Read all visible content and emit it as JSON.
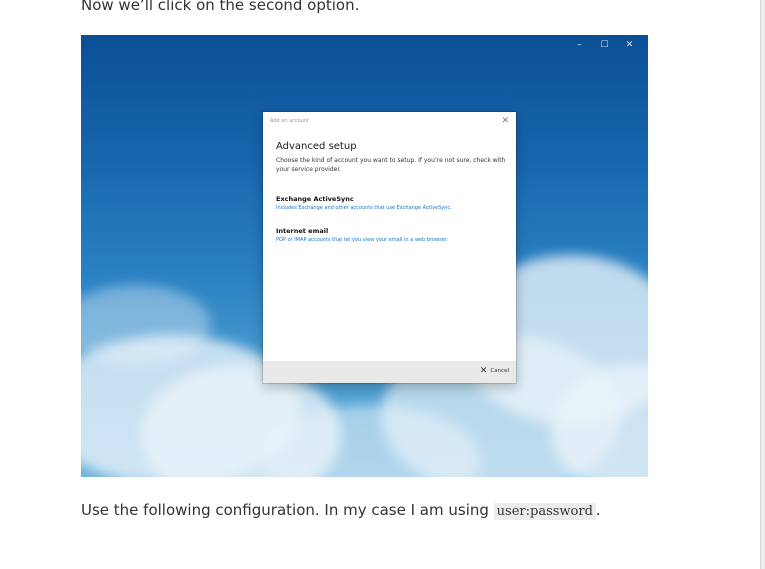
{
  "article": {
    "intro": "Now we’ll click on the second option.",
    "config_prefix": "Use the following configuration. In my case I am using ",
    "config_code": "user:password",
    "config_suffix": "."
  },
  "screenshot": {
    "window_controls": {
      "minimize": "–",
      "maximize": "☐",
      "close": "✕"
    },
    "dialog": {
      "title": "Add an account",
      "close_glyph": "✕",
      "heading": "Advanced setup",
      "description": "Choose the kind of account you want to setup. If you’re not sure, check with your service provider.",
      "options": [
        {
          "title": "Exchange ActiveSync",
          "subtitle": "Includes Exchange and other accounts that use Exchange ActiveSync."
        },
        {
          "title": "Internet email",
          "subtitle": "POP or IMAP accounts that let you view your email in a web browser."
        }
      ],
      "cancel_icon": "✕",
      "cancel_label": "Cancel"
    }
  },
  "colors": {
    "sky_top": "#0b4f95",
    "sky_bottom": "#6cb2dc",
    "link_blue": "#1a73c9"
  }
}
